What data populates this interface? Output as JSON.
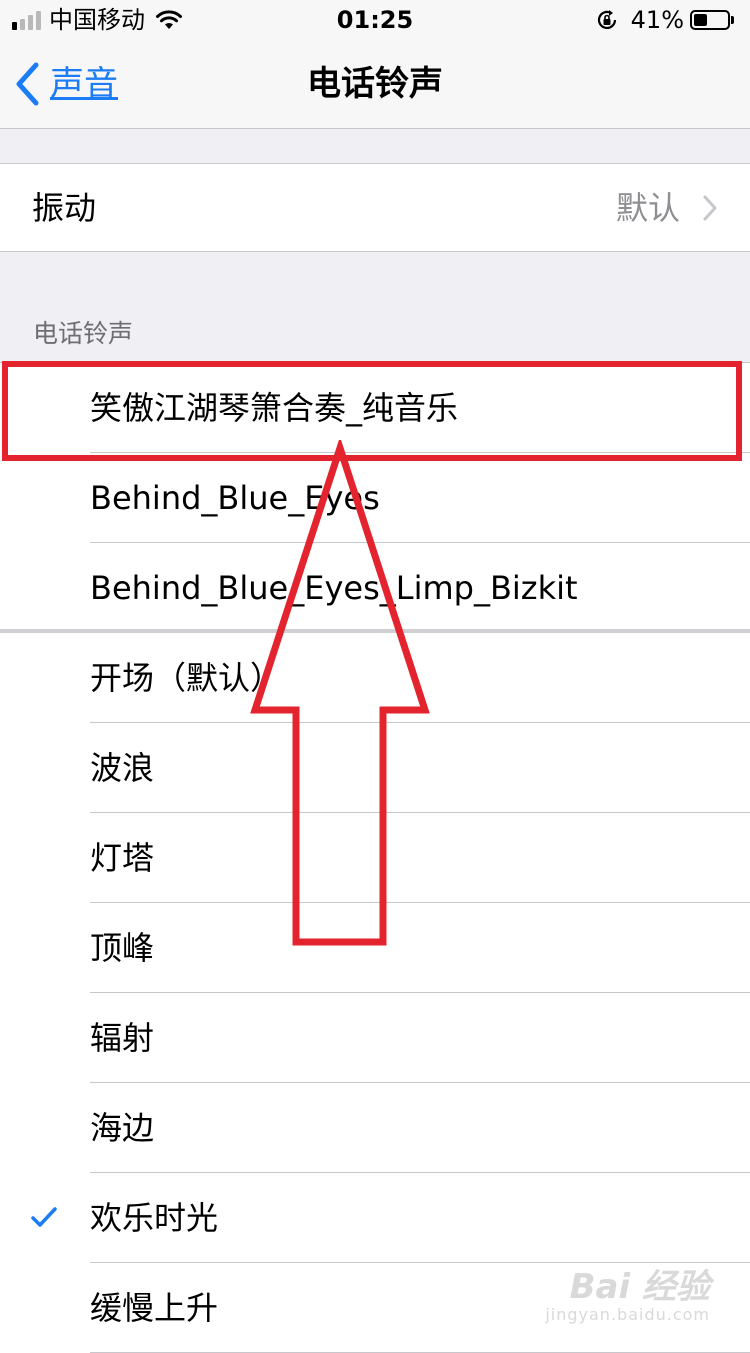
{
  "status_bar": {
    "carrier": "中国移动",
    "time": "01:25",
    "battery_percent": "41%",
    "battery_level": 0.41,
    "signal_bars_active": 1,
    "signal_bars_total": 4
  },
  "nav": {
    "back_label": "声音",
    "title": "电话铃声"
  },
  "vibration": {
    "label": "振动",
    "value": "默认"
  },
  "section_header": "电话铃声",
  "ringtones": [
    {
      "label": "笑傲江湖琴箫合奏_纯音乐",
      "selected": false
    },
    {
      "label": "Behind_Blue_Eyes",
      "selected": false
    },
    {
      "label": "Behind_Blue_Eyes_Limp_Bizkit",
      "selected": false
    },
    {
      "label": "开场（默认）",
      "selected": false
    },
    {
      "label": "波浪",
      "selected": false
    },
    {
      "label": "灯塔",
      "selected": false
    },
    {
      "label": "顶峰",
      "selected": false
    },
    {
      "label": "辐射",
      "selected": false
    },
    {
      "label": "海边",
      "selected": false
    },
    {
      "label": "欢乐时光",
      "selected": true
    },
    {
      "label": "缓慢上升",
      "selected": false
    }
  ],
  "watermark": {
    "main": "Bai 经验",
    "sub": "jingyan.baidu.com"
  },
  "colors": {
    "accent": "#1b7cf5",
    "annotation": "#e3232d",
    "secondary_text": "#8e8e93"
  }
}
